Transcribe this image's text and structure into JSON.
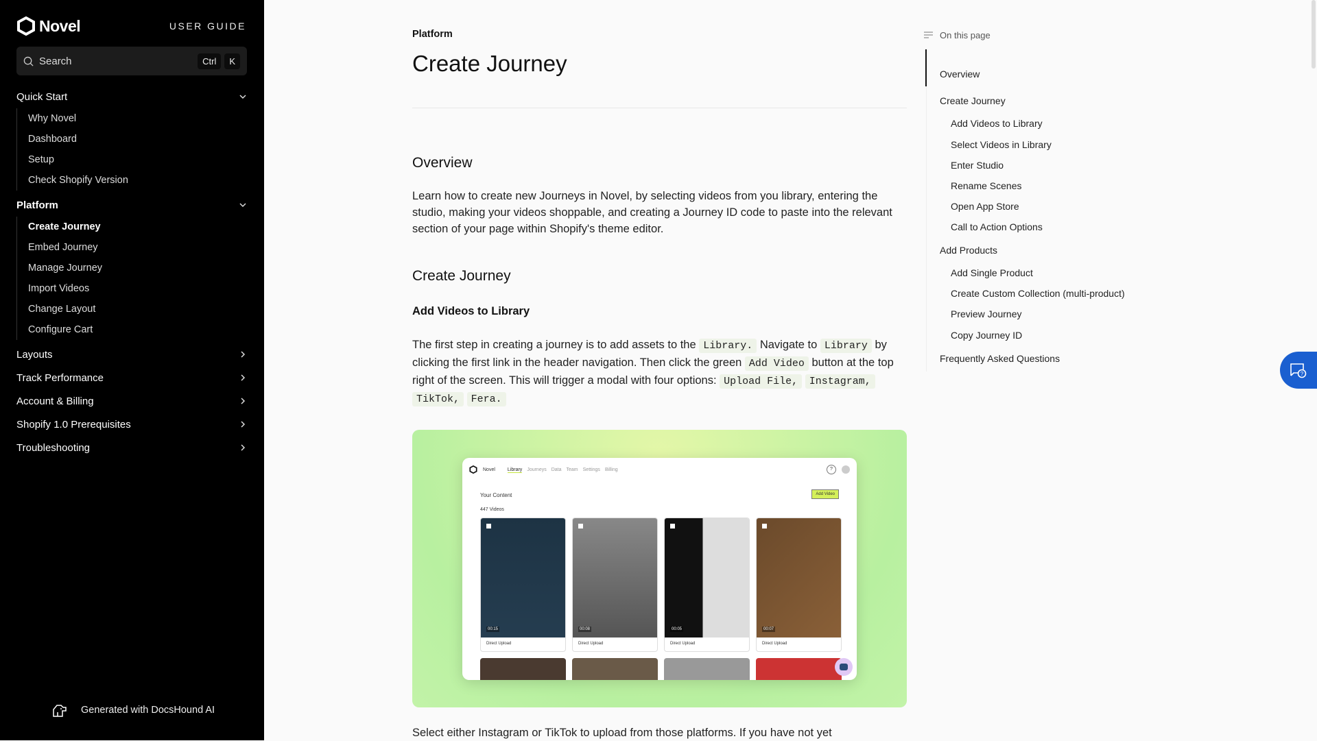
{
  "sidebar": {
    "brand": "Novel",
    "guide": "USER GUIDE",
    "search": {
      "label": "Search",
      "kbd1": "Ctrl",
      "kbd2": "K"
    },
    "sections": [
      {
        "label": "Quick Start",
        "expanded": true,
        "items": [
          "Why Novel",
          "Dashboard",
          "Setup",
          "Check Shopify Version"
        ]
      },
      {
        "label": "Platform",
        "expanded": true,
        "items": [
          "Create Journey",
          "Embed Journey",
          "Manage Journey",
          "Import Videos",
          "Change Layout",
          "Configure Cart"
        ],
        "active": "Create Journey"
      },
      {
        "label": "Layouts",
        "expanded": false
      },
      {
        "label": "Track Performance",
        "expanded": false
      },
      {
        "label": "Account & Billing",
        "expanded": false
      },
      {
        "label": "Shopify 1.0 Prerequisites",
        "expanded": false
      },
      {
        "label": "Troubleshooting",
        "expanded": false
      }
    ],
    "footer": "Generated with DocsHound AI"
  },
  "main": {
    "breadcrumb": "Platform",
    "title": "Create Journey",
    "overview_h": "Overview",
    "overview_p": "Learn how to create new Journeys in Novel, by selecting videos from you library, entering the studio, making your videos shoppable, and creating a Journey ID code to paste into the relevant section of your page within Shopify's theme editor.",
    "create_h": "Create Journey",
    "add_h": "Add Videos to Library",
    "add_p": {
      "t1": "The first step in creating a journey is to add assets to the ",
      "c1": "Library.",
      "t2": " Navigate to ",
      "c2": "Library",
      "t3": " by clicking the first link in the header navigation. Then click the green ",
      "c3": "Add Video",
      "t4": " button at the top right of the screen. This will trigger a modal with four options: ",
      "c4": "Upload File,",
      "c5": "Instagram,",
      "c6": "TikTok,",
      "c7": "Fera."
    },
    "screenshot": {
      "brand": "Novel",
      "tabs": [
        "Library",
        "Journeys",
        "Data",
        "Team",
        "Settings",
        "Billing"
      ],
      "heading": "Your Content",
      "count": "447 Videos",
      "add_button": "Add Video",
      "durations": [
        "00:15",
        "00:08",
        "00:05",
        "00:07"
      ],
      "source": "Direct Upload"
    },
    "last_p": "Select either Instagram or TikTok to upload from those platforms. If you have not yet"
  },
  "toc": {
    "heading": "On this page",
    "items": [
      {
        "label": "Overview",
        "level": 1,
        "active": true
      },
      {
        "label": "Create Journey",
        "level": 1
      },
      {
        "label": "Add Videos to Library",
        "level": 2
      },
      {
        "label": "Select Videos in Library",
        "level": 2
      },
      {
        "label": "Enter Studio",
        "level": 2
      },
      {
        "label": "Rename Scenes",
        "level": 2
      },
      {
        "label": "Open App Store",
        "level": 2
      },
      {
        "label": "Call to Action Options",
        "level": 2
      },
      {
        "label": "Add Products",
        "level": 1
      },
      {
        "label": "Add Single Product",
        "level": 2
      },
      {
        "label": "Create Custom Collection (multi-product)",
        "level": 2
      },
      {
        "label": "Preview Journey",
        "level": 2
      },
      {
        "label": "Copy Journey ID",
        "level": 2
      },
      {
        "label": "Frequently Asked Questions",
        "level": 1
      }
    ]
  },
  "colors": {
    "sidebar": "#000000",
    "accent_chat": "#1a5fd0",
    "code_bg": "#eef3e8"
  }
}
